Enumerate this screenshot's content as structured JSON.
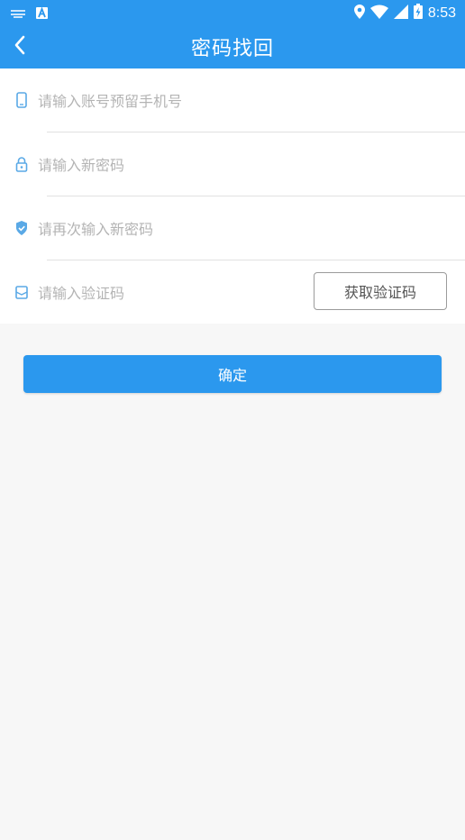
{
  "status_bar": {
    "time": "8:53",
    "icons": [
      "notification-icon",
      "a-letter-icon",
      "location-icon",
      "wifi-icon",
      "signal-icon",
      "battery-icon"
    ]
  },
  "header": {
    "title": "密码找回",
    "back_icon": "back-arrow-icon"
  },
  "form": {
    "phone": {
      "placeholder": "请输入账号预留手机号",
      "icon": "phone-icon"
    },
    "new_password": {
      "placeholder": "请输入新密码",
      "icon": "lock-icon"
    },
    "confirm_password": {
      "placeholder": "请再次输入新密码",
      "icon": "shield-icon"
    },
    "code": {
      "placeholder": "请输入验证码",
      "icon": "mail-icon"
    },
    "get_code_label": "获取验证码"
  },
  "confirm_label": "确定",
  "colors": {
    "accent": "#2b98ee",
    "background": "#f7f7f7",
    "placeholder": "#b4b4b4",
    "icon": "#5aa9e6"
  }
}
